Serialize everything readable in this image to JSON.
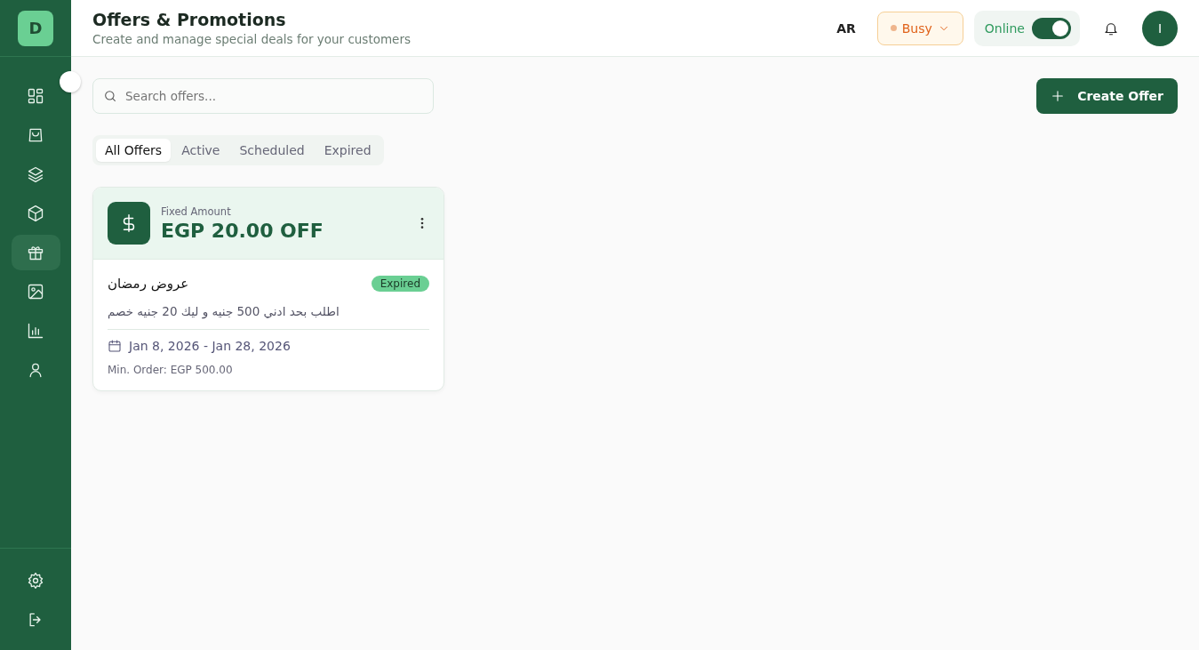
{
  "sidebar": {
    "logo": "D",
    "items": [
      {
        "selected": false
      },
      {
        "selected": false
      },
      {
        "selected": false
      },
      {
        "selected": false
      },
      {
        "selected": true
      },
      {
        "selected": false
      },
      {
        "selected": false
      },
      {
        "selected": false
      }
    ],
    "bottom_items": [
      {
        "selected": false
      },
      {
        "selected": false
      }
    ]
  },
  "header": {
    "title": "Offers & Promotions",
    "subtitle": "Create and manage special deals for your customers",
    "language": "AR",
    "status": "Busy",
    "online": {
      "label": "Online",
      "on": true
    },
    "avatar": "I"
  },
  "search": {
    "placeholder": "Search offers..."
  },
  "create_button": "Create Offer",
  "tabs": [
    {
      "label": "All Offers",
      "selected": true
    },
    {
      "label": "Active",
      "selected": false
    },
    {
      "label": "Scheduled",
      "selected": false
    },
    {
      "label": "Expired",
      "selected": false
    }
  ],
  "offers": [
    {
      "type": "Fixed Amount",
      "amount": "EGP 20.00 OFF",
      "title": "عروض رمضان",
      "status": "Expired",
      "description": "اطلب بحد ادني 500 جنيه و ليك 20 جنيه خصم",
      "dates": "Jan 8, 2026 - Jan 28, 2026",
      "min_order": "Min. Order: EGP 500.00"
    }
  ]
}
